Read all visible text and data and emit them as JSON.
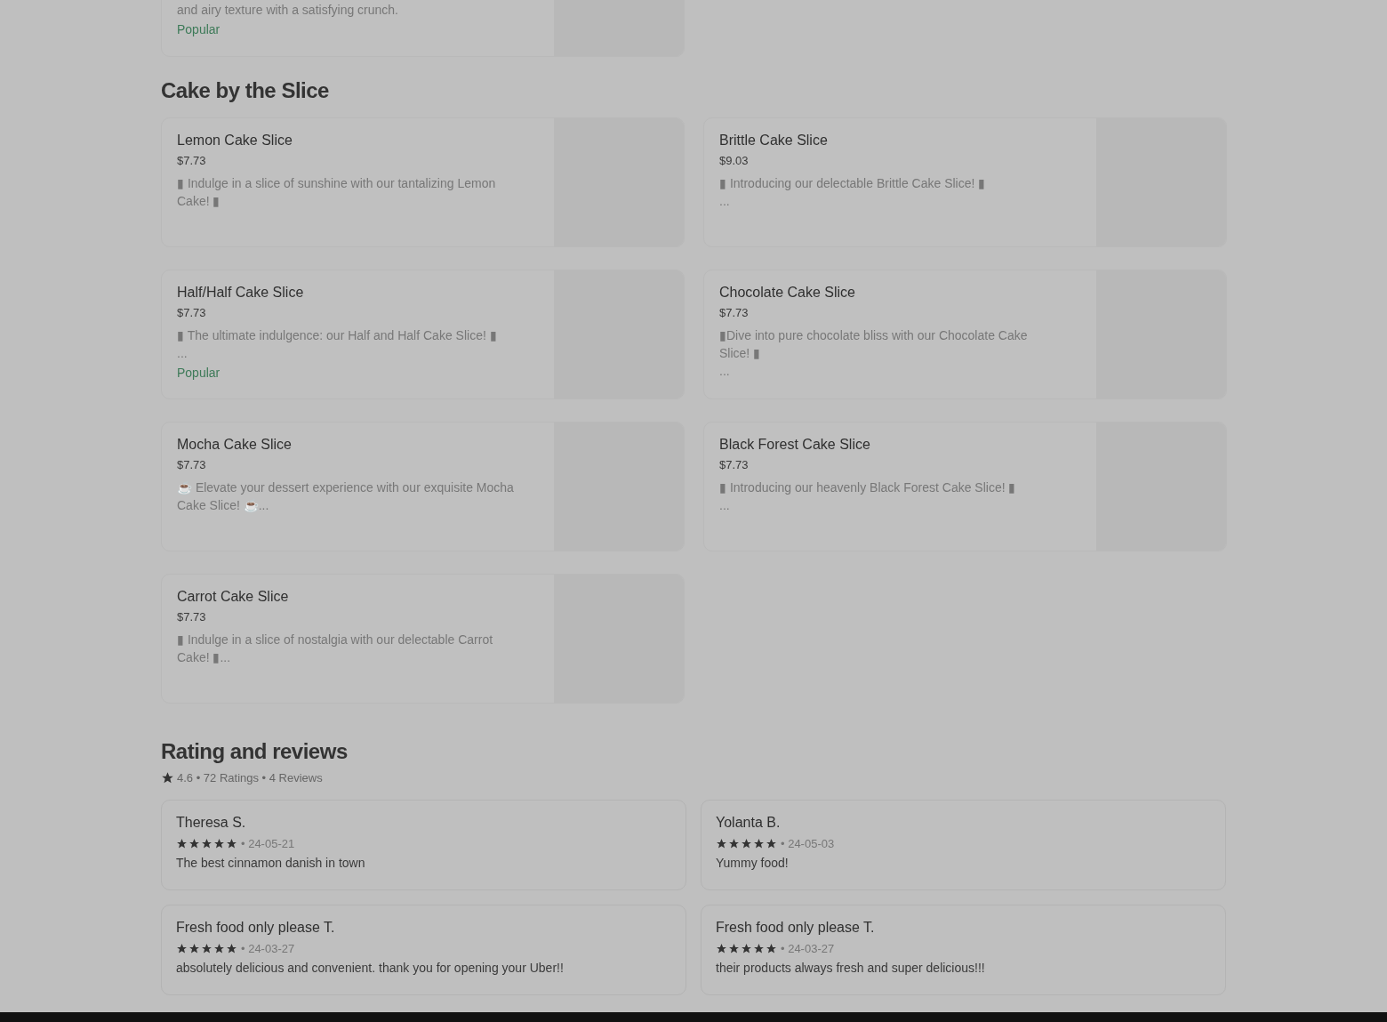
{
  "top_item": {
    "description": "and airy texture with a satisfying crunch.",
    "badge": "Popular"
  },
  "section": {
    "title": "Cake by the Slice",
    "items": [
      {
        "name": "Lemon Cake Slice",
        "price": "$7.73",
        "description": "▮ Indulge in a slice of sunshine with our tantalizing Lemon Cake! ▮"
      },
      {
        "name": "Brittle Cake Slice",
        "price": "$9.03",
        "description": "▮ Introducing our delectable Brittle Cake Slice! ▮\n..."
      },
      {
        "name": "Half/Half Cake Slice",
        "price": "$7.73",
        "description": "▮ The ultimate indulgence: our Half and Half Cake Slice! ▮\n...",
        "badge": "Popular"
      },
      {
        "name": "Chocolate Cake Slice",
        "price": "$7.73",
        "description": "▮Dive into pure chocolate bliss with our Chocolate Cake Slice! ▮\n..."
      },
      {
        "name": "Mocha Cake Slice",
        "price": "$7.73",
        "description": "☕ Elevate your dessert experience with our exquisite Mocha Cake Slice! ☕..."
      },
      {
        "name": "Black Forest Cake Slice",
        "price": "$7.73",
        "description": "▮ Introducing our heavenly Black Forest Cake Slice! ▮\n..."
      },
      {
        "name": "Carrot Cake Slice",
        "price": "$7.73",
        "description": "▮ Indulge in a slice of nostalgia with our delectable Carrot Cake! ▮..."
      }
    ]
  },
  "reviews": {
    "title": "Rating and reviews",
    "summary": "4.6 • 72 Ratings • 4 Reviews",
    "items": [
      {
        "author": "Theresa S.",
        "stars": 5,
        "date": "• 24-05-21",
        "text": "The best cinnamon danish in town"
      },
      {
        "author": "Yolanta B.",
        "stars": 5,
        "date": "• 24-05-03",
        "text": "Yummy food!"
      },
      {
        "author": "Fresh food only please T.",
        "stars": 5,
        "date": "• 24-03-27",
        "text": "absolutely delicious and convenient. thank you for opening your Uber!!"
      },
      {
        "author": "Fresh food only please T.",
        "stars": 5,
        "date": "• 24-03-27",
        "text": "their products always fresh and super delicious!!!"
      }
    ]
  }
}
